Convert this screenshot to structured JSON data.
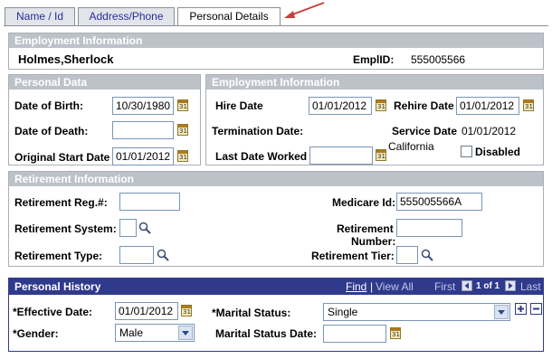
{
  "tabs": [
    {
      "label": "Name / Id"
    },
    {
      "label": "Address/Phone"
    },
    {
      "label": "Personal Details"
    }
  ],
  "employment_info": {
    "header": "Employment Information",
    "name": "Holmes,Sherlock",
    "emplid_label": "EmplID:",
    "emplid": "555005566"
  },
  "personal_data": {
    "header": "Personal Data",
    "dob_label": "Date of Birth:",
    "dob": "10/30/1980",
    "dod_label": "Date of Death:",
    "dod": "",
    "ost_label": "Original Start Date",
    "ost": "01/01/2012"
  },
  "employment_box": {
    "header": "Employment Information",
    "hire_label": "Hire Date",
    "hire": "01/01/2012",
    "rehire_label": "Rehire Date",
    "rehire": "01/01/2012",
    "term_label": "Termination Date:",
    "service_label": "Service Date",
    "service": "01/01/2012",
    "state": "California",
    "lwd_label": "Last Date Worked",
    "lwd": "",
    "disabled_label": "Disabled"
  },
  "retirement": {
    "header": "Retirement Information",
    "reg_label": "Retirement Reg.#:",
    "reg": "",
    "medicare_label": "Medicare Id:",
    "medicare": "555005566A",
    "system_label": "Retirement System:",
    "system": "",
    "number_label_1": "Retirement",
    "number_label_2": "Number:",
    "number": "",
    "type_label": "Retirement Type:",
    "type": "",
    "tier_label": "Retirement Tier:",
    "tier": ""
  },
  "history": {
    "header": "Personal History",
    "find": "Find",
    "sep": "|",
    "view_all": "View All",
    "first": "First",
    "pager": "1 of 1",
    "last": "Last",
    "eff_label": "*Effective Date:",
    "eff": "01/01/2012",
    "marital_label": "*Marital Status:",
    "marital": "Single",
    "gender_label": "*Gender:",
    "gender": "Male",
    "msd_label": "Marital Status Date:",
    "msd": ""
  },
  "colors": {
    "header_grey": "#bcc2c8",
    "header_blue": "#2f3a8c",
    "link": "#2c2c9a",
    "arrow": "#c8403c"
  }
}
